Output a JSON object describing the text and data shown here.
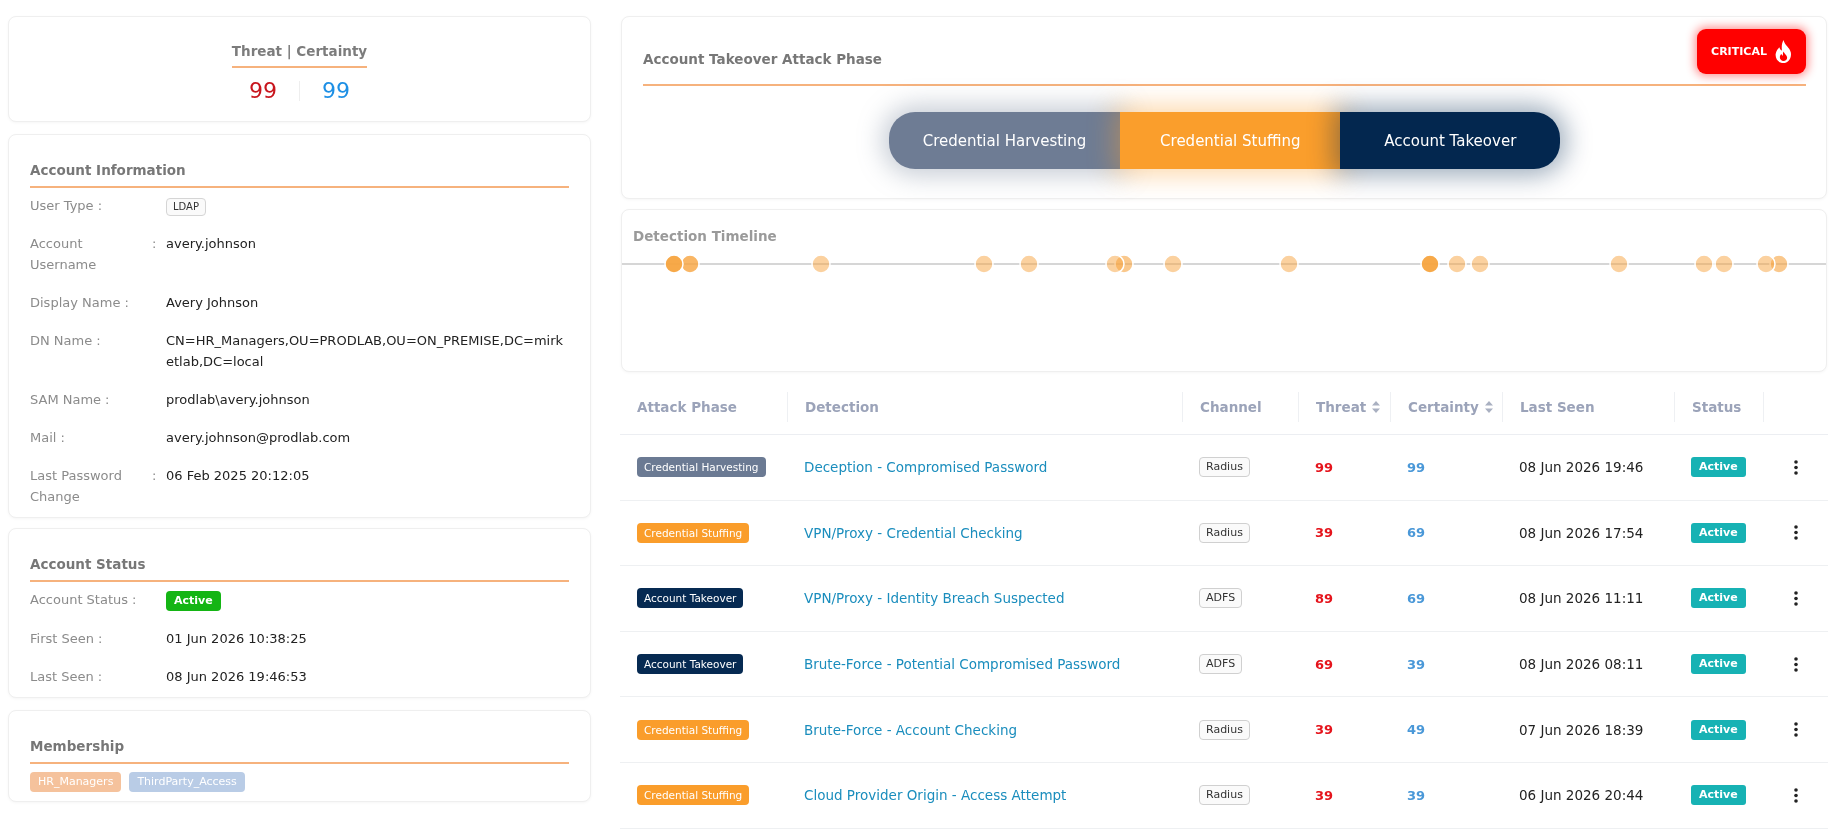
{
  "score_card": {
    "title": "Threat | Certainty",
    "threat": "99",
    "certainty": "99"
  },
  "account_information": {
    "title": "Account Information",
    "rows": [
      {
        "label": "User Type",
        "colon": ":",
        "value": "LDAP",
        "kind": "tag"
      },
      {
        "label": "Account Username",
        "colon": ":",
        "value": "avery.johnson",
        "kind": "text"
      },
      {
        "label": "Display Name",
        "colon": ":",
        "value": "Avery Johnson",
        "kind": "text"
      },
      {
        "label": "DN Name",
        "colon": ":",
        "value": "CN=HR_Managers,OU=PRODLAB,OU=ON_PREMISE,DC=mirketlab,DC=local",
        "kind": "text"
      },
      {
        "label": "SAM Name",
        "colon": ":",
        "value": "prodlab\\avery.johnson",
        "kind": "text"
      },
      {
        "label": "Mail",
        "colon": ":",
        "value": "avery.johnson@prodlab.com",
        "kind": "text"
      },
      {
        "label": "Last Password Change",
        "colon": ":",
        "value": "06 Feb 2025 20:12:05",
        "kind": "text"
      }
    ]
  },
  "account_status": {
    "title": "Account Status",
    "rows": [
      {
        "label": "Account Status",
        "colon": ":",
        "value": "Active",
        "kind": "status"
      },
      {
        "label": "First Seen",
        "colon": ":",
        "value": "01 Jun 2026 10:38:25",
        "kind": "text"
      },
      {
        "label": "Last Seen",
        "colon": ":",
        "value": "08 Jun 2026 19:46:53",
        "kind": "text"
      }
    ]
  },
  "membership": {
    "title": "Membership",
    "groups": [
      {
        "label": "HR_Managers",
        "color": "#f5c29c"
      },
      {
        "label": "ThirdParty_Access",
        "color": "#b9cce6"
      }
    ]
  },
  "attack_phase": {
    "title": "Account Takeover Attack Phase",
    "severity": "CRITICAL",
    "phases": [
      {
        "label": "Credential Harvesting",
        "color": "#6e7c94"
      },
      {
        "label": "Credential Stuffing",
        "color": "#fa9e2c"
      },
      {
        "label": "Account Takeover",
        "color": "#03274f"
      }
    ]
  },
  "detection_timeline": {
    "title": "Detection Timeline"
  },
  "table": {
    "columns": [
      {
        "label": "Attack Phase",
        "sortable": false
      },
      {
        "label": "Detection",
        "sortable": false
      },
      {
        "label": "Channel",
        "sortable": false
      },
      {
        "label": "Threat",
        "sortable": true
      },
      {
        "label": "Certainty",
        "sortable": true
      },
      {
        "label": "Last Seen",
        "sortable": false
      },
      {
        "label": "Status",
        "sortable": false
      }
    ],
    "rows": [
      {
        "phase": {
          "label": "Credential Harvesting",
          "color": "#6b7a93"
        },
        "detection": "Deception - Compromised Password",
        "channel": "Radius",
        "threat": "99",
        "certainty": "99",
        "last_seen": "08 Jun 2026 19:46",
        "status": "Active"
      },
      {
        "phase": {
          "label": "Credential Stuffing",
          "color": "#fa9d2b"
        },
        "detection": "VPN/Proxy - Credential Checking",
        "channel": "Radius",
        "threat": "39",
        "certainty": "69",
        "last_seen": "08 Jun 2026 17:54",
        "status": "Active"
      },
      {
        "phase": {
          "label": "Account Takeover",
          "color": "#062a52"
        },
        "detection": "VPN/Proxy - Identity Breach Suspected",
        "channel": "ADFS",
        "threat": "89",
        "certainty": "69",
        "last_seen": "08 Jun 2026 11:11",
        "status": "Active"
      },
      {
        "phase": {
          "label": "Account Takeover",
          "color": "#062a52"
        },
        "detection": "Brute-Force - Potential Compromised Password",
        "channel": "ADFS",
        "threat": "69",
        "certainty": "39",
        "last_seen": "08 Jun 2026 08:11",
        "status": "Active"
      },
      {
        "phase": {
          "label": "Credential Stuffing",
          "color": "#fa9d2b"
        },
        "detection": "Brute-Force - Account Checking",
        "channel": "Radius",
        "threat": "39",
        "certainty": "49",
        "last_seen": "07 Jun 2026 18:39",
        "status": "Active"
      },
      {
        "phase": {
          "label": "Credential Stuffing",
          "color": "#fa9d2b"
        },
        "detection": "Cloud Provider Origin - Access Attempt",
        "channel": "Radius",
        "threat": "39",
        "certainty": "39",
        "last_seen": "06 Jun 2026 20:44",
        "status": "Active"
      }
    ]
  }
}
